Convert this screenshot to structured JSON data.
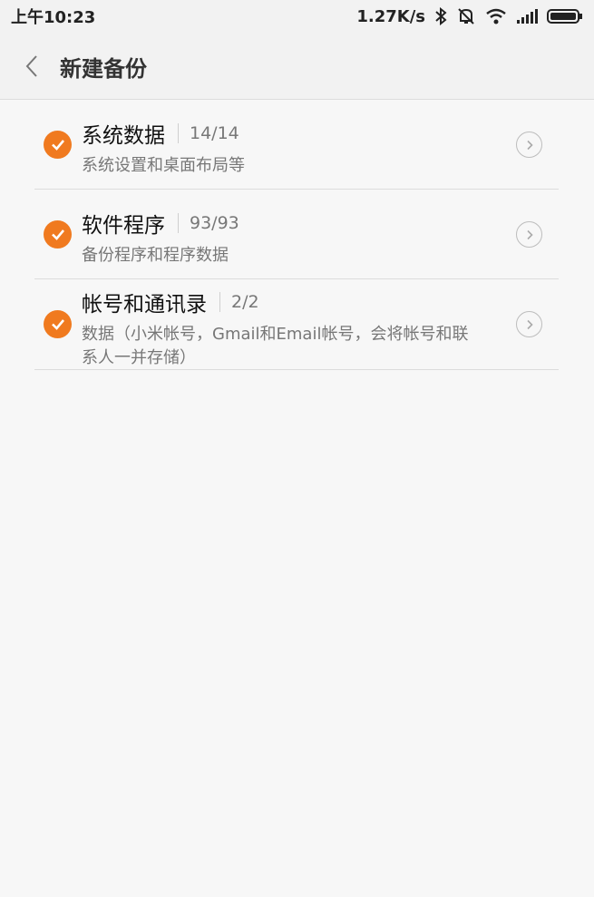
{
  "status_bar": {
    "time": "上午10:23",
    "net_speed": "1.27K/s",
    "icons": [
      "bluetooth-icon",
      "mute-icon",
      "wifi-icon",
      "signal-icon",
      "battery-icon"
    ]
  },
  "header": {
    "back_icon": "chevron-left-icon",
    "title": "新建备份"
  },
  "items": [
    {
      "name": "系统数据",
      "count": "14/14",
      "desc": "系统设置和桌面布局等",
      "checked": true
    },
    {
      "name": "软件程序",
      "count": "93/93",
      "desc": "备份程序和程序数据",
      "checked": true
    },
    {
      "name": "帐号和通讯录",
      "count": "2/2",
      "desc": "数据（小米帐号，Gmail和Email帐号，会将帐号和联系人一并存储）",
      "checked": true
    }
  ],
  "colors": {
    "accent": "#f07a1f",
    "background": "#f7f7f7"
  }
}
